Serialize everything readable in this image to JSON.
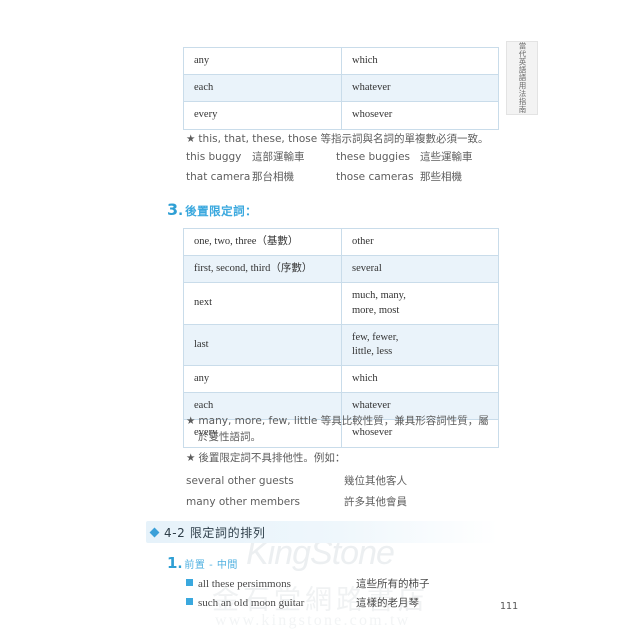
{
  "document": {
    "page_number": "111",
    "side_tab_label": "當代英語語用法指南"
  },
  "watermarks": {
    "brand": "KingStone",
    "brand_cn": "金石堂網路書店",
    "url": "www.kingstone.com.tw"
  },
  "table_top": {
    "rows": [
      {
        "left": "any",
        "right": "which"
      },
      {
        "left": "each",
        "right": "whatever"
      },
      {
        "left": "every",
        "right": "whosever"
      }
    ]
  },
  "note_demonstratives": {
    "star": "★",
    "text": "this, that, these, those 等指示詞與名詞的單複數必須一致。"
  },
  "examples_demonstratives": [
    {
      "en1": "this buggy",
      "zh1": "這部運輸車",
      "en2": "these buggies",
      "zh2": "這些運輸車"
    },
    {
      "en1": "that camera",
      "zh1": "那台相機",
      "en2": "those cameras",
      "zh2": "那些相機"
    }
  ],
  "heading_3": {
    "number": "3",
    "dot": ".",
    "text": "後置限定詞："
  },
  "table_main": {
    "rows": [
      {
        "left": "one, two, three（基數）",
        "right": "other"
      },
      {
        "left": "first, second, third（序數）",
        "right": "several"
      },
      {
        "left": "next",
        "right": "much, many,\nmore, most"
      },
      {
        "left": "last",
        "right": "few, fewer,\nlittle, less"
      },
      {
        "left": "any",
        "right": "which"
      },
      {
        "left": "each",
        "right": "whatever"
      },
      {
        "left": "every",
        "right": "whosever"
      }
    ]
  },
  "note_comparative": {
    "star": "★",
    "line1": "many, more, few, little 等具比較性質，兼具形容詞性質，屬",
    "line2": "於雙性語詞。"
  },
  "note_nonexclusive": {
    "star": "★",
    "text": "後置限定詞不具排他性。例如："
  },
  "examples_nonexclusive": [
    {
      "en": "several other guests",
      "zh": "幾位其他客人"
    },
    {
      "en": "many other members",
      "zh": "許多其他會員"
    }
  ],
  "section_4_2": {
    "title": "4-2 限定詞的排列"
  },
  "heading_1": {
    "number": "1",
    "dot": ".",
    "text": "前置 - 中間"
  },
  "examples_order": [
    {
      "en": "all these persimmons",
      "zh": "這些所有的柿子"
    },
    {
      "en": "such an old moon guitar",
      "zh": "這樣的老月琴"
    }
  ]
}
